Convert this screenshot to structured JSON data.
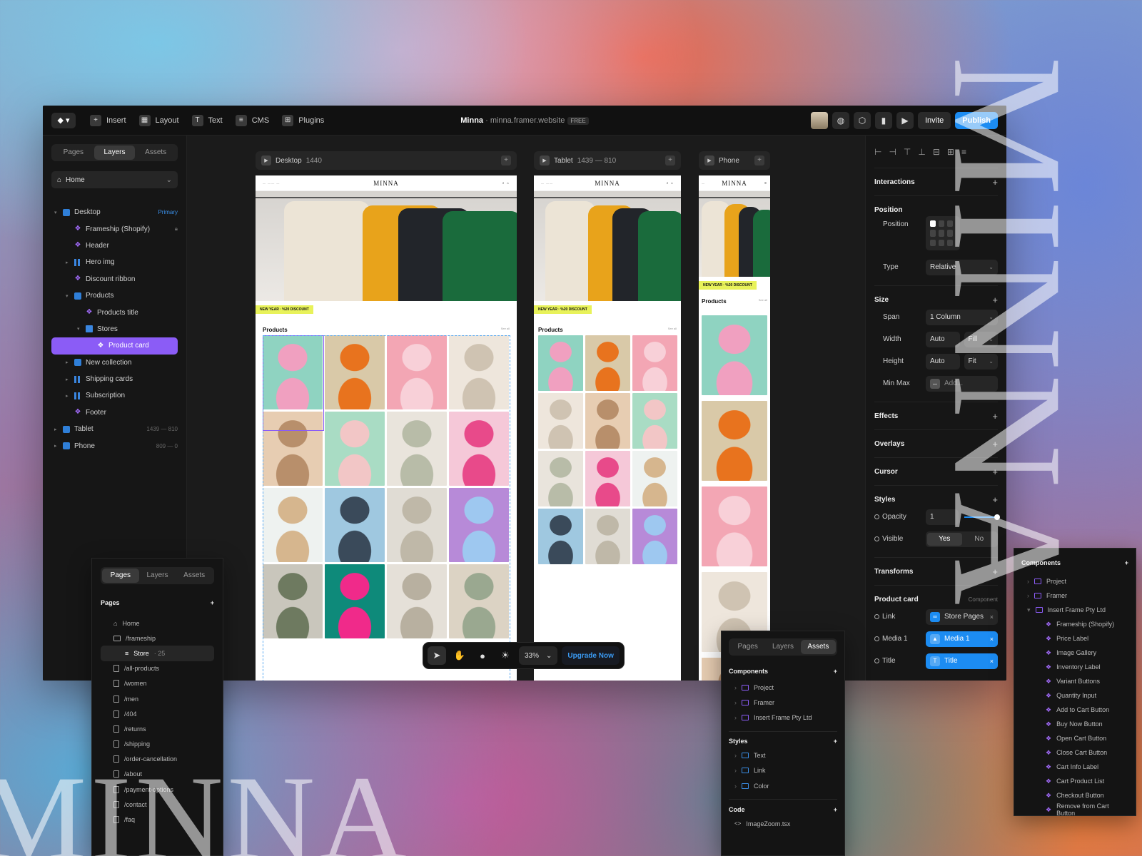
{
  "brand": "MINNA",
  "topbar": {
    "logo": "framer-logo-icon",
    "menu": [
      {
        "label": "Insert",
        "icon": "plus-icon"
      },
      {
        "label": "Layout",
        "icon": "layout-icon"
      },
      {
        "label": "Text",
        "icon": "text-icon"
      },
      {
        "label": "CMS",
        "icon": "database-icon"
      },
      {
        "label": "Plugins",
        "icon": "grid-icon"
      }
    ],
    "project": "Minna",
    "sep": " · ",
    "domain": "minna.framer.website",
    "plan": "FREE",
    "invite": "Invite",
    "publish": "Publish"
  },
  "left": {
    "tabs": [
      "Pages",
      "Layers",
      "Assets"
    ],
    "page": "Home",
    "layers": [
      {
        "label": "Desktop",
        "tag": "Primary"
      },
      {
        "label": "Frameship (Shopify)"
      },
      {
        "label": "Header"
      },
      {
        "label": "Hero img"
      },
      {
        "label": "Discount ribbon"
      },
      {
        "label": "Products"
      },
      {
        "label": "Products title"
      },
      {
        "label": "Stores"
      },
      {
        "label": "Product card"
      },
      {
        "label": "New collection"
      },
      {
        "label": "Shipping cards"
      },
      {
        "label": "Subscription"
      },
      {
        "label": "Footer"
      },
      {
        "label": "Tablet",
        "dim": "1439 — 810"
      },
      {
        "label": "Phone",
        "dim": "809 — 0"
      }
    ]
  },
  "frames": {
    "desktop": {
      "name": "Desktop",
      "dim": "1440"
    },
    "tablet": {
      "name": "Tablet",
      "dim": "1439 — 810"
    },
    "phone": {
      "name": "Phone"
    }
  },
  "site": {
    "ribbon": "NEW YEAR  ·  %20 DISCOUNT",
    "products_title": "Products",
    "see_all": "See all"
  },
  "right": {
    "interactions": "Interactions",
    "position": "Position",
    "position_label": "Position",
    "type_label": "Type",
    "type_value": "Relative",
    "size": "Size",
    "span_label": "Span",
    "span_value": "1 Column",
    "width_label": "Width",
    "width_value": "Auto",
    "width_mode": "Fill",
    "height_label": "Height",
    "height_value": "Auto",
    "height_mode": "Fit",
    "minmax_label": "Min Max",
    "minmax_value": "Add...",
    "effects": "Effects",
    "overlays": "Overlays",
    "cursor": "Cursor",
    "styles": "Styles",
    "opacity_label": "Opacity",
    "opacity_value": "1",
    "visible_label": "Visible",
    "visible_yes": "Yes",
    "visible_no": "No",
    "transforms": "Transforms",
    "product_card": "Product card",
    "component": "Component",
    "link_label": "Link",
    "link_value": "Store Pages",
    "media_label": "Media 1",
    "media_value": "Media 1",
    "title_label": "Title",
    "title_value": "Title"
  },
  "pages_panel": {
    "tabs": [
      "Pages",
      "Layers",
      "Assets"
    ],
    "heading": "Pages",
    "items": [
      {
        "label": "Home"
      },
      {
        "label": "/frameship"
      },
      {
        "label": "Store",
        "count": "· 25"
      },
      {
        "label": "/all-products"
      },
      {
        "label": "/women"
      },
      {
        "label": "/men"
      },
      {
        "label": "/404"
      },
      {
        "label": "/returns"
      },
      {
        "label": "/shipping"
      },
      {
        "label": "/order-cancellation"
      },
      {
        "label": "/about"
      },
      {
        "label": "/payment-options"
      },
      {
        "label": "/contact"
      },
      {
        "label": "/faq"
      }
    ]
  },
  "assets_panel": {
    "tabs": [
      "Pages",
      "Layers",
      "Assets"
    ],
    "components": "Components",
    "components_items": [
      "Project",
      "Framer",
      "Insert Frame Pty Ltd"
    ],
    "styles": "Styles",
    "styles_items": [
      "Text",
      "Link",
      "Color"
    ],
    "code": "Code",
    "code_items": [
      "ImageZoom.tsx"
    ]
  },
  "components_panel": {
    "heading": "Components",
    "folders": [
      "Project",
      "Framer",
      "Insert Frame Pty Ltd"
    ],
    "items": [
      "Frameship (Shopify)",
      "Price Label",
      "Image Gallery",
      "Inventory Label",
      "Variant Buttons",
      "Quantity Input",
      "Add to Cart Button",
      "Buy Now Button",
      "Open Cart Button",
      "Close Cart Button",
      "Cart Info Label",
      "Cart Product List",
      "Checkout Button",
      "Remove from Cart Button"
    ]
  },
  "toolbar": {
    "zoom": "33%",
    "upgrade": "Upgrade Now"
  },
  "colors": {
    "accent": "#1c8cf2",
    "selection": "#8b5cf6",
    "ribbon": "#e8f25a",
    "price": "#e04a2f"
  }
}
